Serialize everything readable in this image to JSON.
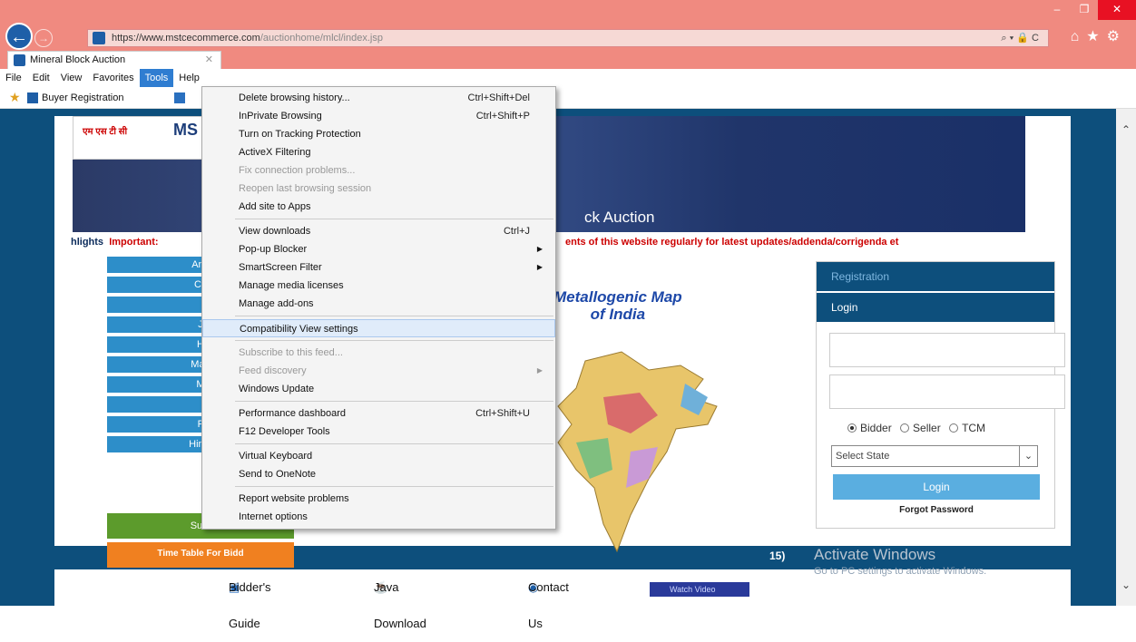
{
  "browser": {
    "url_host": "https://www.mstcecommerce.com",
    "url_path": "/auctionhome/mlcl/index.jsp",
    "address_controls": "⌕ ▾ 🔒 C",
    "tab_title": "Mineral Block Auction",
    "tab_close": "✕",
    "window_controls": {
      "min": "–",
      "max": "❐",
      "close": "✕"
    },
    "menubar": [
      "File",
      "Edit",
      "View",
      "Favorites",
      "Tools",
      "Help"
    ],
    "active_menu": "Tools",
    "favorites": [
      {
        "label": "Buyer Registration"
      }
    ]
  },
  "tools_menu": {
    "groups": [
      [
        {
          "label": "Delete browsing history...",
          "shortcut": "Ctrl+Shift+Del",
          "disabled": false
        },
        {
          "label": "InPrivate Browsing",
          "shortcut": "Ctrl+Shift+P",
          "disabled": false
        },
        {
          "label": "Turn on Tracking Protection",
          "shortcut": "",
          "disabled": false
        },
        {
          "label": "ActiveX Filtering",
          "shortcut": "",
          "disabled": false
        },
        {
          "label": "Fix connection problems...",
          "shortcut": "",
          "disabled": true
        },
        {
          "label": "Reopen last browsing session",
          "shortcut": "",
          "disabled": true
        },
        {
          "label": "Add site to Apps",
          "shortcut": "",
          "disabled": false
        }
      ],
      [
        {
          "label": "View downloads",
          "shortcut": "Ctrl+J",
          "disabled": false
        },
        {
          "label": "Pop-up Blocker",
          "shortcut": "",
          "submenu": true,
          "disabled": false
        },
        {
          "label": "SmartScreen Filter",
          "shortcut": "",
          "submenu": true,
          "disabled": false
        },
        {
          "label": "Manage media licenses",
          "shortcut": "",
          "disabled": false
        },
        {
          "label": "Manage add-ons",
          "shortcut": "",
          "disabled": false
        }
      ],
      [
        {
          "label": "Compatibility View settings",
          "shortcut": "",
          "disabled": false,
          "highlighted": true
        }
      ],
      [
        {
          "label": "Subscribe to this feed...",
          "shortcut": "",
          "disabled": true
        },
        {
          "label": "Feed discovery",
          "shortcut": "",
          "submenu": true,
          "disabled": true
        },
        {
          "label": "Windows Update",
          "shortcut": "",
          "disabled": false
        }
      ],
      [
        {
          "label": "Performance dashboard",
          "shortcut": "Ctrl+Shift+U",
          "disabled": false
        },
        {
          "label": "F12 Developer Tools",
          "shortcut": "",
          "disabled": false
        }
      ],
      [
        {
          "label": "Virtual Keyboard",
          "shortcut": "",
          "disabled": false
        },
        {
          "label": "Send to OneNote",
          "shortcut": "",
          "disabled": false
        }
      ],
      [
        {
          "label": "Report website problems",
          "shortcut": "",
          "disabled": false
        },
        {
          "label": "Internet options",
          "shortcut": "",
          "disabled": false
        }
      ]
    ]
  },
  "page": {
    "logo_hindi": "एम एस टी सी",
    "logo_en": "MS",
    "banner_title": "ck Auction",
    "ticker_highlight": "hlights",
    "ticker_text": "Important:",
    "ticker_text2": "ents of this website regularly for latest updates/addenda/corrigenda et",
    "left_nav": [
      "And",
      "Ch",
      "",
      "J",
      "H",
      "Mad",
      "M",
      "",
      "F",
      "Hima"
    ],
    "green_button": "Sum",
    "orange_button": "Time Table For Bidd",
    "map_title_1": "Metallogenic Map",
    "map_title_2": "of India",
    "tiny_label": "15)",
    "login": {
      "registration_tab": "Registration",
      "login_tab": "Login",
      "roles": [
        "Bidder",
        "Seller",
        "TCM"
      ],
      "selected_role": "Bidder",
      "state_placeholder": "Select State",
      "login_button": "Login",
      "forgot": "Forgot Password"
    },
    "bottom_links": [
      "Bidder's Guide",
      "Java Download",
      "Contact Us"
    ],
    "watch_video": "Watch Video",
    "watermark_1": "Activate Windows",
    "watermark_2": "Go to PC settings to activate Windows."
  }
}
